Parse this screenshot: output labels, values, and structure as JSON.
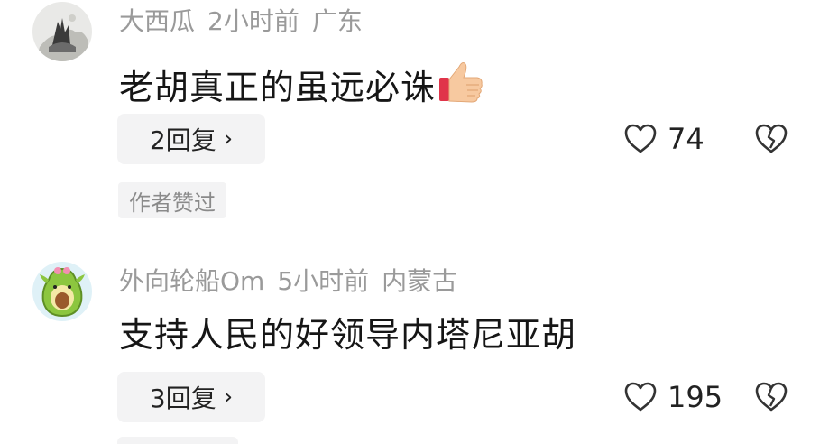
{
  "comments": [
    {
      "username": "大西瓜",
      "time": "2小时前",
      "location": "广东",
      "text": "老胡真正的虽远必诛",
      "avatar_icon": "ink-landscape-avatar",
      "reply_label": "2回复",
      "likes": "74",
      "badge": "作者赞过"
    },
    {
      "username": "外向轮船Om",
      "time": "5小时前",
      "location": "内蒙古",
      "text": "支持人民的好领导内塔尼亚胡",
      "avatar_icon": "avocado-avatar",
      "reply_label": "3回复",
      "likes": "195"
    }
  ],
  "icons": {
    "reply_chevron": "›",
    "like": "heart-outline-icon",
    "dislike": "broken-heart-icon",
    "emoji": "thumbs-up-emoji"
  },
  "colors": {
    "meta_text": "#9a9a9a",
    "body_text": "#161616",
    "pill_bg": "#f3f3f4",
    "avocado_green": "#8cc63f"
  }
}
